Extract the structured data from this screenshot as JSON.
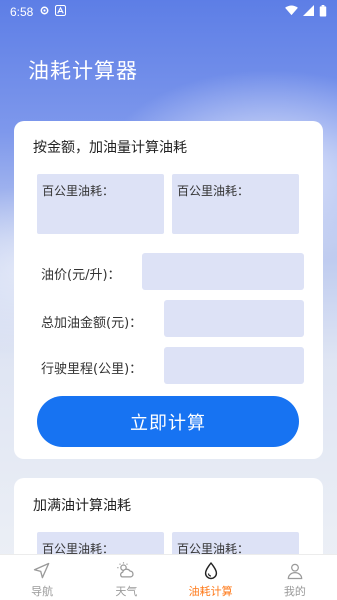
{
  "status_bar": {
    "time": "6:58"
  },
  "app_title": "油耗计算器",
  "card1": {
    "title": "按金额，加油量计算油耗",
    "results": [
      {
        "label": "百公里油耗："
      },
      {
        "label": "百公里油耗："
      }
    ],
    "rows": [
      {
        "label": "油价(元/升)：",
        "value": ""
      },
      {
        "label": "总加油金额(元)：",
        "value": ""
      },
      {
        "label": "行驶里程(公里)：",
        "value": ""
      }
    ],
    "button_label": "立即计算"
  },
  "card2": {
    "title": "加满油计算油耗",
    "results": [
      {
        "label": "百公里油耗："
      },
      {
        "label": "百公里油耗："
      }
    ]
  },
  "nav": {
    "items": [
      {
        "label": "导航",
        "icon": "navigation-icon",
        "active": false
      },
      {
        "label": "天气",
        "icon": "weather-icon",
        "active": false
      },
      {
        "label": "油耗计算",
        "icon": "fuel-drop-icon",
        "active": true
      },
      {
        "label": "我的",
        "icon": "profile-icon",
        "active": false
      }
    ],
    "active_color": "#ff7a1a",
    "inactive_color": "#9a9a9a"
  },
  "colors": {
    "accent": "#1773f2",
    "input_bg": "#dde2f6"
  }
}
